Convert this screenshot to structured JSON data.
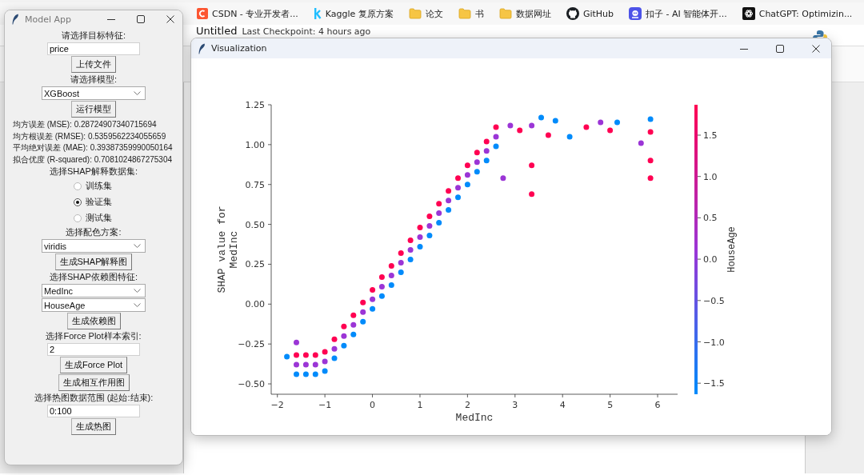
{
  "bookmarks_bar": {
    "items": [
      {
        "kind": "site",
        "label": "CSDN - 专业开发者..."
      },
      {
        "kind": "site",
        "label": "Kaggle 复原方案"
      },
      {
        "kind": "folder",
        "label": "论文"
      },
      {
        "kind": "folder",
        "label": "书"
      },
      {
        "kind": "folder",
        "label": "数据网址"
      },
      {
        "kind": "site",
        "label": "GitHub"
      },
      {
        "kind": "site",
        "label": "扣子 - AI 智能体开..."
      },
      {
        "kind": "site",
        "label": "ChatGPT: Optimizin..."
      }
    ]
  },
  "notebook": {
    "title": "Untitled",
    "checkpoint": "Last Checkpoint: 4 hours ago"
  },
  "model_app": {
    "window": {
      "title": "Model App"
    },
    "controls": [
      {
        "kind": "label",
        "text": "请选择目标特征:"
      },
      {
        "kind": "entry",
        "value": "price"
      },
      {
        "kind": "button",
        "text": "上传文件"
      },
      {
        "kind": "label",
        "text": "请选择模型:"
      },
      {
        "kind": "combobox",
        "value": "XGBoost"
      },
      {
        "kind": "button",
        "text": "运行模型"
      },
      {
        "kind": "metric",
        "text": "均方误差 (MSE): 0.28724907340715694"
      },
      {
        "kind": "metric",
        "text": "均方根误差 (RMSE): 0.5359562234055659"
      },
      {
        "kind": "metric",
        "text": "平均绝对误差 (MAE): 0.39387359990050164"
      },
      {
        "kind": "metric",
        "text": "拟合优度 (R-squared): 0.7081024867275304"
      },
      {
        "kind": "label",
        "text": "选择SHAP解释数据集:"
      },
      {
        "kind": "radio",
        "text": "训练集",
        "selected": false
      },
      {
        "kind": "radio",
        "text": "验证集",
        "selected": true
      },
      {
        "kind": "radio",
        "text": "测试集",
        "selected": false
      },
      {
        "kind": "label",
        "text": "选择配色方案:"
      },
      {
        "kind": "combobox",
        "value": "viridis"
      },
      {
        "kind": "button",
        "text": "生成SHAP解释图"
      },
      {
        "kind": "label",
        "text": "选择SHAP依赖图特征:"
      },
      {
        "kind": "combobox",
        "value": "MedInc"
      },
      {
        "kind": "combobox",
        "value": "HouseAge"
      },
      {
        "kind": "button",
        "text": "生成依赖图"
      },
      {
        "kind": "label",
        "text": "选择Force Plot样本索引:"
      },
      {
        "kind": "entry",
        "value": "2"
      },
      {
        "kind": "button",
        "text": "生成Force Plot"
      },
      {
        "kind": "button",
        "text": "生成相互作用图"
      },
      {
        "kind": "label",
        "text": "选择热图数据范围 (起始:结束):"
      },
      {
        "kind": "entry",
        "value": "0:100"
      },
      {
        "kind": "button",
        "text": "生成热图"
      }
    ]
  },
  "visualization": {
    "window": {
      "title": "Visualization"
    },
    "chart_data": {
      "type": "scatter",
      "xlabel": "MedInc",
      "ylabel": "SHAP value for\nMedInc",
      "xlim": [
        -2.13,
        6.42
      ],
      "ylim": [
        -0.565,
        1.25
      ],
      "xticks": [
        {
          "value": -2,
          "label": "−2"
        },
        {
          "value": -1,
          "label": "−1"
        },
        {
          "value": 0,
          "label": "0"
        },
        {
          "value": 1,
          "label": "1"
        },
        {
          "value": 2,
          "label": "2"
        },
        {
          "value": 3,
          "label": "3"
        },
        {
          "value": 4,
          "label": "4"
        },
        {
          "value": 5,
          "label": "5"
        },
        {
          "value": 6,
          "label": "6"
        }
      ],
      "yticks": [
        {
          "value": 1.25,
          "label": "1.25"
        },
        {
          "value": 1,
          "label": "1.00"
        },
        {
          "value": 0.75,
          "label": "0.75"
        },
        {
          "value": 0.5,
          "label": "0.50"
        },
        {
          "value": 0.25,
          "label": "0.25"
        },
        {
          "value": 0,
          "label": "0.00"
        },
        {
          "value": -0.25,
          "label": "−0.25"
        },
        {
          "value": -0.5,
          "label": "−0.50"
        }
      ],
      "x": [
        -1.6,
        -1.4,
        -1.2,
        -1.0,
        -0.8,
        -0.6,
        -0.4,
        -0.2,
        0,
        0.2,
        0.4,
        0.6,
        0.8,
        1.0,
        1.2,
        1.4,
        1.6,
        1.8,
        2.0,
        2.2,
        2.4,
        2.6,
        2.75,
        2.9,
        3.1,
        3.35,
        3.35,
        3.35,
        3.55,
        3.7,
        3.85,
        4.15,
        4.5,
        4.8,
        5.0,
        5.15,
        5.65,
        5.85,
        5.85,
        5.85,
        5.85,
        -1.8,
        -1.6
      ],
      "series": [
        {
          "color": "#ff0052",
          "values": [
            -0.32,
            -0.32,
            -0.32,
            -0.3,
            -0.22,
            -0.14,
            -0.07,
            0.01,
            0.09,
            0.17,
            0.24,
            0.32,
            0.4,
            0.48,
            0.55,
            0.63,
            0.71,
            0.79,
            0.87,
            0.95,
            1.02,
            1.11,
            null,
            null,
            1.09,
            0.87,
            0.69,
            null,
            null,
            1.06,
            null,
            null,
            1.11,
            null,
            1.09,
            null,
            null,
            null,
            1.08,
            0.9,
            0.79,
            null,
            null
          ]
        },
        {
          "color": "#9b35d6",
          "values": [
            -0.38,
            -0.38,
            -0.38,
            -0.36,
            -0.28,
            -0.2,
            -0.13,
            -0.05,
            0.03,
            0.11,
            0.18,
            0.26,
            0.34,
            0.42,
            0.49,
            0.57,
            0.65,
            0.73,
            0.81,
            0.89,
            0.96,
            1.05,
            0.79,
            1.12,
            null,
            null,
            null,
            1.12,
            null,
            null,
            null,
            null,
            null,
            1.14,
            null,
            null,
            1.01,
            null,
            null,
            null,
            null,
            null,
            -0.24
          ]
        },
        {
          "color": "#008bfb",
          "values": [
            -0.44,
            -0.44,
            -0.44,
            -0.42,
            -0.34,
            -0.26,
            -0.19,
            -0.11,
            -0.03,
            0.05,
            0.12,
            0.2,
            0.28,
            0.36,
            0.43,
            0.51,
            0.59,
            0.67,
            0.75,
            0.83,
            0.9,
            0.99,
            null,
            null,
            null,
            null,
            null,
            null,
            1.17,
            null,
            1.15,
            1.05,
            null,
            null,
            null,
            1.14,
            null,
            1.16,
            null,
            null,
            null,
            -0.33,
            null
          ]
        }
      ]
    },
    "colorbar": {
      "label": "HouseAge",
      "ticks": [
        "1.5",
        "1.0",
        "0.5",
        "0.0",
        "−0.5",
        "−1.0",
        "−1.5"
      ]
    }
  }
}
